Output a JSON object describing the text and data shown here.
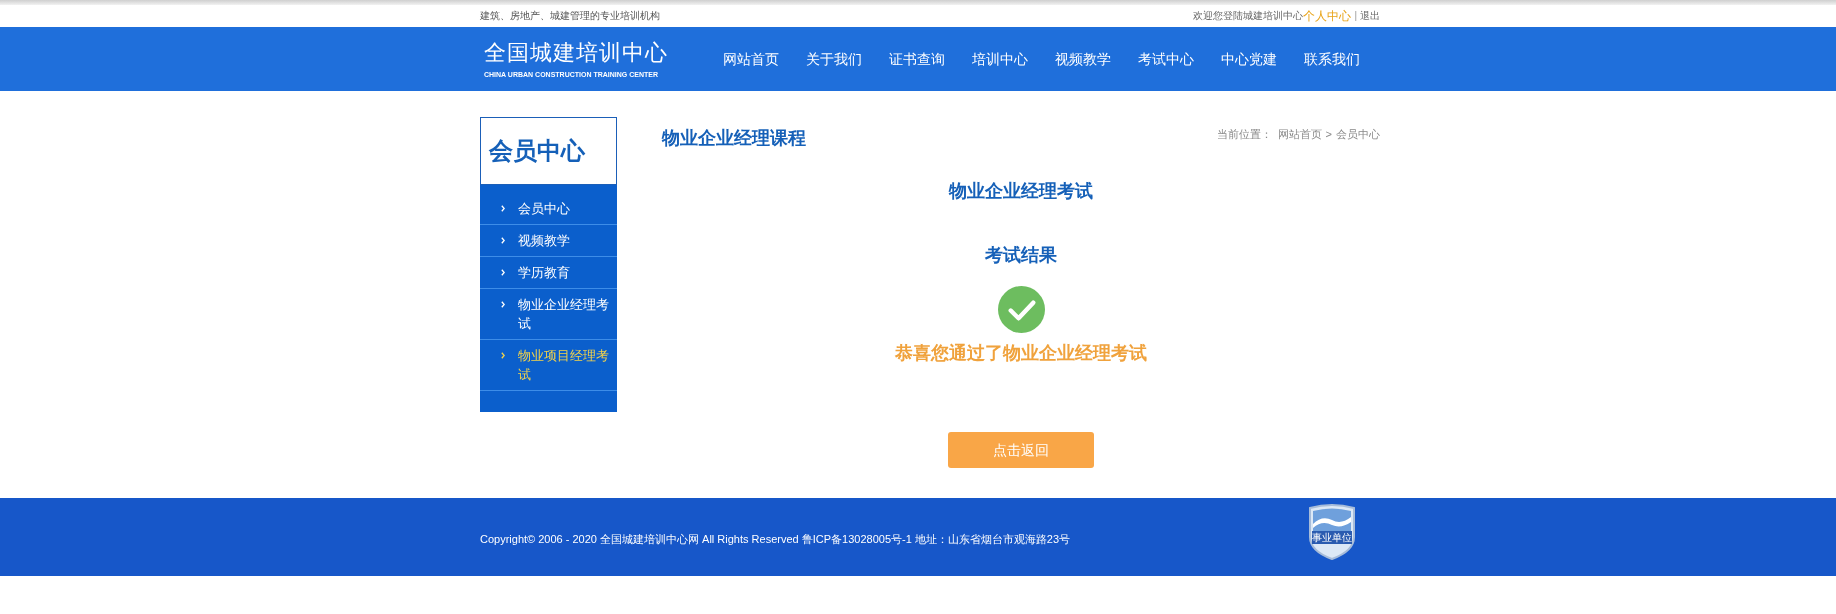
{
  "top_bar": {
    "tagline": "建筑、房地产、城建管理的专业培训机构",
    "welcome": "欢迎您登陆城建培训中心",
    "user_link": "个人中心",
    "separator": "|",
    "logout": "退出"
  },
  "header": {
    "logo_title": "全国城建培训中心",
    "logo_subtitle": "CHINA URBAN CONSTRUCTION TRAINING CENTER",
    "nav": [
      "网站首页",
      "关于我们",
      "证书查询",
      "培训中心",
      "视频教学",
      "考试中心",
      "中心党建",
      "联系我们"
    ]
  },
  "sidebar": {
    "title": "会员中心",
    "items": [
      {
        "label": "会员中心",
        "selected": false
      },
      {
        "label": "视频教学",
        "selected": false
      },
      {
        "label": "学历教育",
        "selected": false
      },
      {
        "label": "物业企业经理考试",
        "selected": false
      },
      {
        "label": "物业项目经理考试",
        "selected": true
      }
    ]
  },
  "main": {
    "title": "物业企业经理课程",
    "breadcrumb": {
      "prefix": "当前位置：",
      "links": [
        "网站首页",
        "会员中心"
      ],
      "separator": ">"
    }
  },
  "exam": {
    "name": "物业企业经理考试",
    "result_heading": "考试结果",
    "passed": true,
    "message": "恭喜您通过了物业企业经理考试",
    "back_button": "点击返回"
  },
  "footer": {
    "copyright": "Copyright© 2006 - 2020 全国城建培训中心网 All Rights Reserved 鲁ICP备13028005号-1 地址：山东省烟台市观海路23号",
    "badge_label": "事业单位"
  }
}
